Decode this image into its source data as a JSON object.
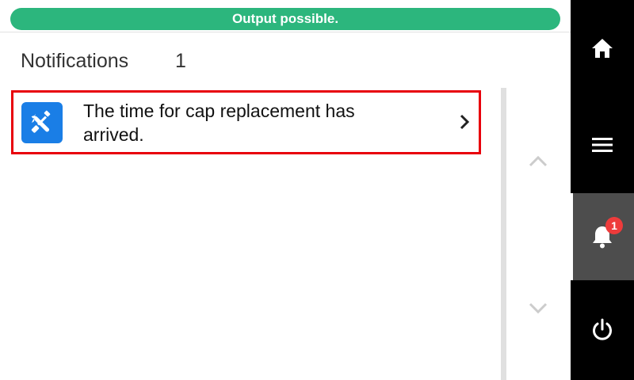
{
  "status": {
    "text": "Output possible.",
    "color": "#2cb67d"
  },
  "header": {
    "title": "Notifications",
    "count": "1"
  },
  "notifications": [
    {
      "icon": "tools-icon",
      "icon_bg": "#1a7ee6",
      "message": "The time for cap replacement has arrived.",
      "selected": true,
      "highlight_color": "#e8000b"
    }
  ],
  "scroll": {
    "up_icon": "chevron-up-icon",
    "down_icon": "chevron-down-icon"
  },
  "sidebar": {
    "items": [
      {
        "icon": "home-icon"
      },
      {
        "icon": "menu-icon"
      },
      {
        "icon": "bell-icon",
        "badge": "1",
        "active": true,
        "badge_color": "#ee3b3b"
      },
      {
        "icon": "power-icon"
      }
    ]
  }
}
